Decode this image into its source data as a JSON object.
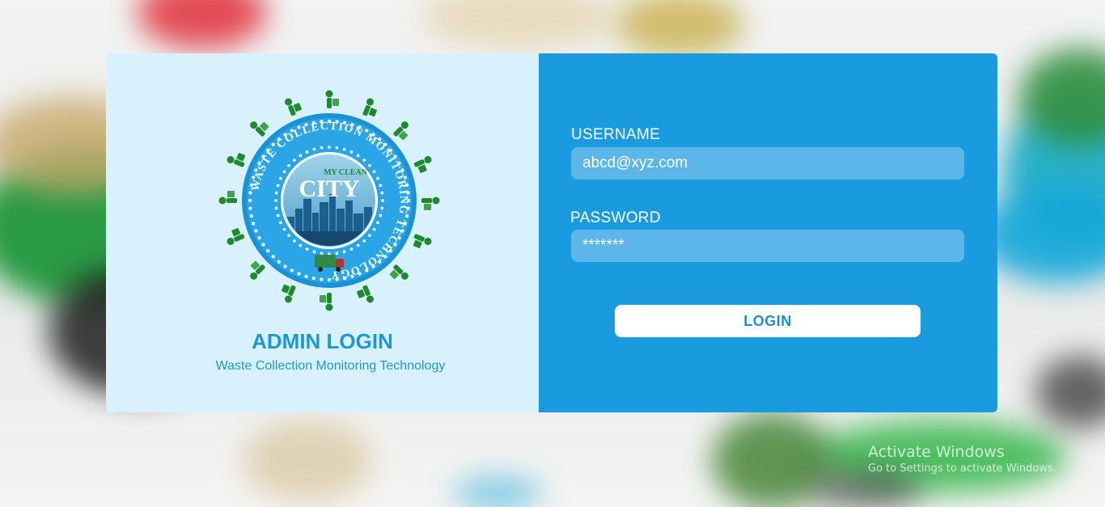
{
  "login_panel": {
    "title": "ADMIN LOGIN",
    "subtitle": "Waste Collection Monitoring Technology",
    "logo": {
      "ring_text": "WASTE COLLECTION MONITORING TECHNOLOGY",
      "top_text": "MY CLEAN",
      "main_text": "CITY"
    }
  },
  "form": {
    "username_label": "USERNAME",
    "username_value": "abcd@xyz.com",
    "password_label": "PASSWORD",
    "password_value": "*******",
    "login_label": "LOGIN"
  },
  "watermark": {
    "title": "Activate Windows",
    "subtitle": "Go to Settings to activate Windows."
  },
  "colors": {
    "left_panel": "#d9f1fd",
    "right_panel": "#1a9be0",
    "accent": "#1b98d8",
    "field": "#5db6e9",
    "logo_green": "#1e8a2c"
  }
}
